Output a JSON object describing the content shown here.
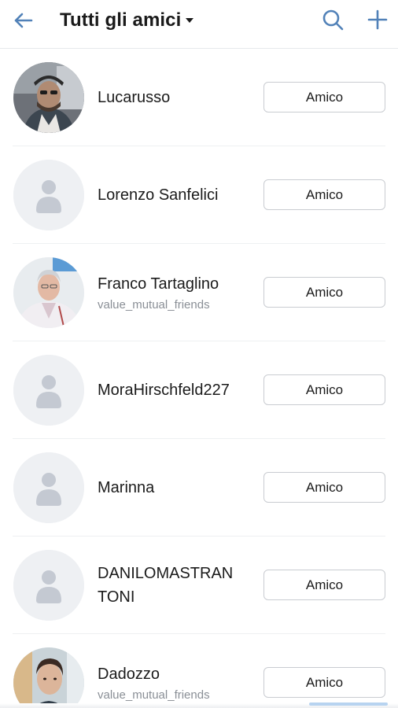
{
  "header": {
    "title": "Tutti gli amici",
    "icons": [
      "back-arrow-icon",
      "caret-down-icon",
      "search-icon",
      "plus-icon"
    ]
  },
  "colors": {
    "accent": "#5181b8",
    "button_border": "#c9ccd1",
    "secondary_text": "#8a8f96"
  },
  "friends": [
    {
      "name": "Lucarusso",
      "subtitle": "",
      "avatar": "photo",
      "button": "Amico"
    },
    {
      "name": "Lorenzo Sanfelici",
      "subtitle": "",
      "avatar": "placeholder",
      "button": "Amico"
    },
    {
      "name": "Franco Tartaglino",
      "subtitle": "value_mutual_friends",
      "avatar": "photo",
      "button": "Amico"
    },
    {
      "name": "MoraHirschfeld227",
      "subtitle": "",
      "avatar": "placeholder",
      "button": "Amico"
    },
    {
      "name": "Marinna",
      "subtitle": "",
      "avatar": "placeholder",
      "button": "Amico"
    },
    {
      "name": "DANILOMASTRAN TONI",
      "subtitle": "",
      "avatar": "placeholder",
      "button": "Amico"
    },
    {
      "name": "Dadozzo",
      "subtitle": "value_mutual_friends",
      "avatar": "photo",
      "button": "Amico"
    }
  ]
}
